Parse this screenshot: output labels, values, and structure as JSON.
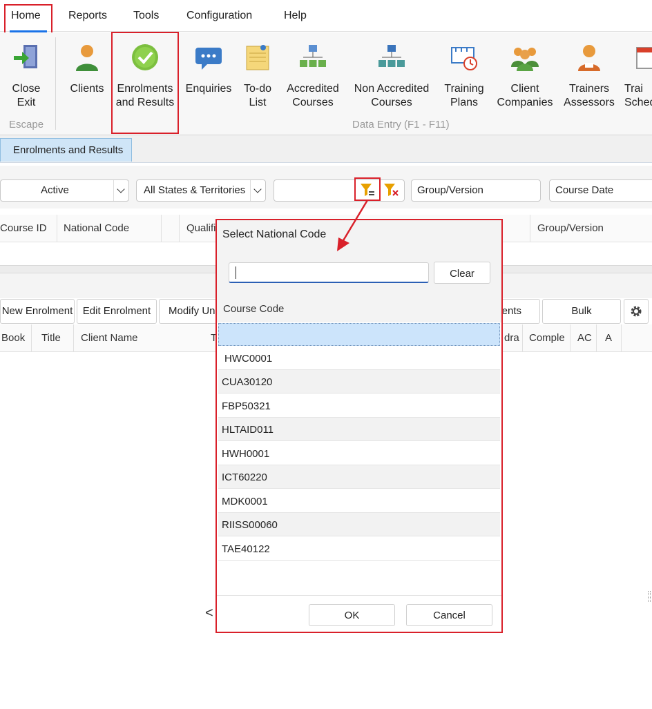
{
  "menu": {
    "home": "Home",
    "reports": "Reports",
    "tools": "Tools",
    "configuration": "Configuration",
    "help": "Help"
  },
  "ribbon": {
    "close": "Close\nExit",
    "clients": "Clients",
    "enrolments": "Enrolments\nand Results",
    "enquiries": "Enquiries",
    "todo": "To-do\nList",
    "accredited": "Accredited\nCourses",
    "non_accredited": "Non Accredited\nCourses",
    "training_plans": "Training\nPlans",
    "client_companies": "Client\nCompanies",
    "trainers": "Trainers\nAssessors",
    "training_schedule": "Trai\nSched",
    "group_escape": "Escape",
    "group_data_entry": "Data Entry (F1 - F11)"
  },
  "tab": {
    "enrolments": "Enrolments and Results"
  },
  "filters": {
    "status": "Active",
    "states": "All States & Territories",
    "group_version": "Group/Version",
    "course_date": "Course Date"
  },
  "course_grid": {
    "headers": [
      "Course ID",
      "National Code",
      "Qualifi",
      "Group/Version"
    ]
  },
  "toolbar": {
    "new_enrolment": "New Enrolment",
    "edit_enrolment": "Edit Enrolment",
    "modify": "Modify Un",
    "documents": "ents",
    "bulk": "Bulk"
  },
  "enrol_grid": {
    "headers": [
      "Book",
      "Title",
      "Client Name",
      "T",
      "dra",
      "Comple",
      "AC",
      "A"
    ]
  },
  "background_chevron": "<",
  "popup": {
    "title": "Select National Code",
    "search_value": "",
    "clear": "Clear",
    "column": "Course Code",
    "rows": [
      "",
      "HWC0001",
      "CUA30120",
      "FBP50321",
      "HLTAID011",
      "HWH0001",
      "ICT60220",
      "MDK0001",
      "RIISS00060",
      "TAE40122"
    ],
    "ok": "OK",
    "cancel": "Cancel"
  },
  "colors": {
    "highlight": "#d9202a",
    "selected_row": "#cce4fb",
    "tab": "#cfe5f7",
    "accent": "#1a73e8",
    "filter_icon": "#e7a000"
  }
}
